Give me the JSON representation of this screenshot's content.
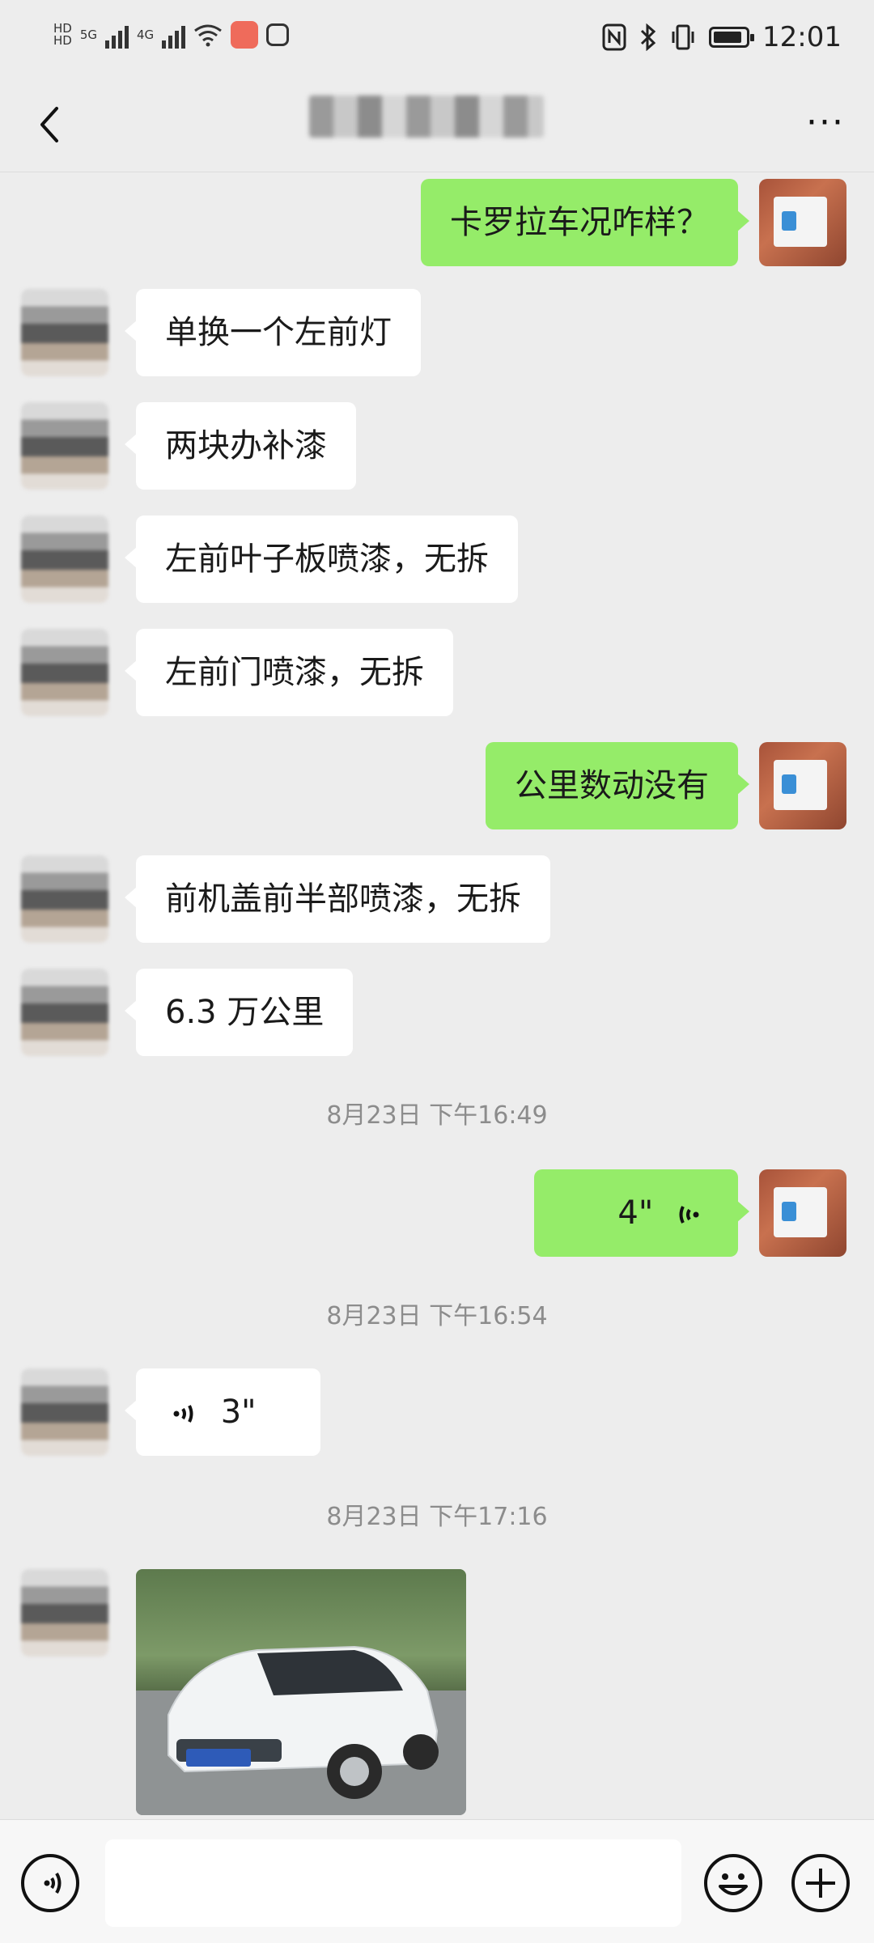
{
  "status_bar": {
    "time": "12:01",
    "network_left": [
      "HD",
      "5G",
      "4G"
    ],
    "icons": [
      "signal-icon",
      "wifi-icon",
      "app-notification-icon",
      "hexagon-icon",
      "nfc-icon",
      "bluetooth-icon",
      "vibrate-icon",
      "battery-icon"
    ]
  },
  "navbar": {
    "back_icon": "chevron-left-icon",
    "more_icon": "more-dots-icon",
    "more_label": "···"
  },
  "messages": [
    {
      "side": "right",
      "type": "text",
      "text": "卡罗拉车况咋样？"
    },
    {
      "side": "left",
      "type": "text",
      "text": "单换一个左前灯"
    },
    {
      "side": "left",
      "type": "text",
      "text": "两块办补漆"
    },
    {
      "side": "left",
      "type": "text",
      "text": "左前叶子板喷漆，无拆"
    },
    {
      "side": "left",
      "type": "text",
      "text": "左前门喷漆，无拆"
    },
    {
      "side": "right",
      "type": "text",
      "text": "公里数动没有"
    },
    {
      "side": "left",
      "type": "text",
      "text": "前机盖前半部喷漆，无拆"
    },
    {
      "side": "left",
      "type": "text",
      "text": "6.3 万公里"
    },
    {
      "type": "timestamp",
      "text": "8月23日 下午16:49"
    },
    {
      "side": "right",
      "type": "voice",
      "duration": "4\""
    },
    {
      "type": "timestamp",
      "text": "8月23日 下午16:54"
    },
    {
      "side": "left",
      "type": "voice",
      "duration": "3\""
    },
    {
      "type": "timestamp",
      "text": "8月23日 下午17:16"
    },
    {
      "side": "left",
      "type": "image",
      "description_icon": "car-photo"
    }
  ],
  "input_bar": {
    "voice_icon": "voice-input-icon",
    "placeholder": "",
    "emoji_icon": "emoji-icon",
    "plus_icon": "plus-icon"
  },
  "colors": {
    "background": "#ededed",
    "sent_bubble": "#95ec69",
    "received_bubble": "#ffffff",
    "timestamp_text": "#8c8c8c"
  }
}
